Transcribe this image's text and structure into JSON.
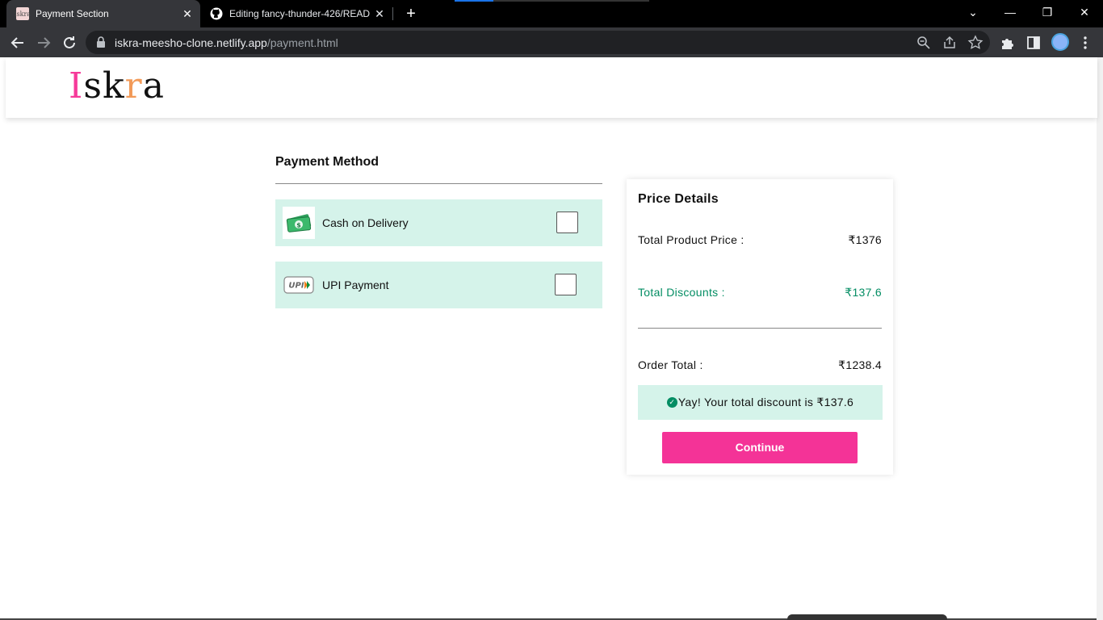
{
  "browser": {
    "tabs": [
      {
        "title": "Payment Section",
        "favicon_text": "iskra",
        "active": true
      },
      {
        "title": "Editing fancy-thunder-426/READ",
        "favicon": "github-icon",
        "active": false
      }
    ],
    "close_glyph": "✕",
    "new_tab_glyph": "+",
    "window_controls": {
      "dropdown": "⌄",
      "minimize": "—",
      "restore": "❐",
      "close": "✕"
    },
    "url_domain": "iskra-meesho-clone.netlify.app",
    "url_path": "/payment.html"
  },
  "site": {
    "logo": {
      "letter1": "I",
      "letter2": "sk",
      "letter3": "r",
      "letter4": "a",
      "colors": {
        "i": "#f63a9a",
        "r": "#f29a58"
      }
    }
  },
  "payment": {
    "title": "Payment Method",
    "options": [
      {
        "label": "Cash on Delivery",
        "icon": "cash-icon",
        "checked": false
      },
      {
        "label": "UPI Payment",
        "icon": "upi-icon",
        "checked": false
      }
    ]
  },
  "price_details": {
    "title": "Price Details",
    "product_price_label": "Total Product Price :",
    "product_price_value": "₹1376",
    "discounts_label": "Total Discounts :",
    "discounts_value": "₹137.6",
    "order_total_label": "Order Total :",
    "order_total_value": "₹1238.4",
    "yay_message": "Yay! Your total discount is ₹137.6",
    "continue_label": "Continue"
  },
  "colors": {
    "accent": "#f43397",
    "mint": "#d5f3ea",
    "green": "#038d63"
  }
}
